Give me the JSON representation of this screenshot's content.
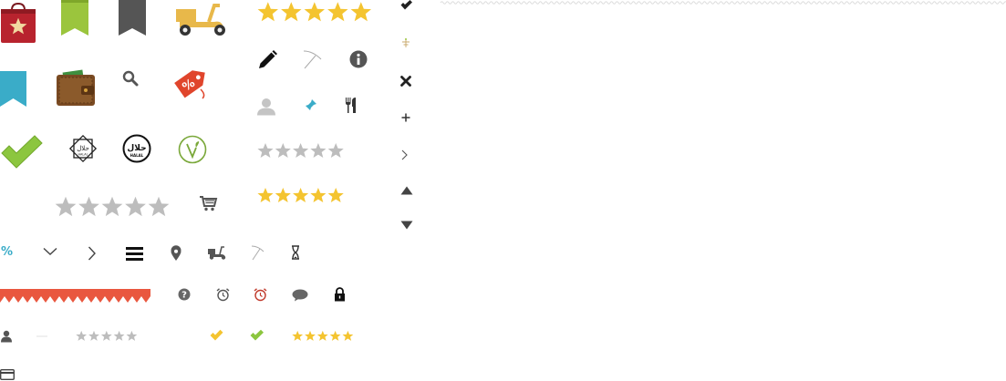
{
  "sprite_sheet": {
    "rows": {
      "row1": [
        "gift-bag-star-icon",
        "green-ribbon-bookmark-icon",
        "gray-ribbon-bookmark-icon",
        "delivery-scooter-icon"
      ],
      "row2": [
        "blue-ribbon-bookmark-icon",
        "wallet-icon",
        "search-icon",
        "discount-tag-icon"
      ],
      "row3": [
        "big-check-icon",
        "halal-star-icon",
        "halal-circle-icon",
        "vegetarian-leaf-icon"
      ],
      "row4": [
        "gray-star-rating-large",
        "shopping-cart-icon"
      ],
      "row5": [
        "percent-icon",
        "chevron-down-icon",
        "chevron-right-icon",
        "hamburger-menu-icon",
        "map-pin-icon",
        "small-scooter-icon",
        "pickaxe-icon",
        "hourglass-icon"
      ],
      "row6": [
        "orange-zigzag-banner",
        "question-icon",
        "alarm-clock-gray-icon",
        "alarm-clock-red-icon",
        "speech-bubble-icon",
        "lock-icon"
      ],
      "row7": [
        "user-icon",
        "small-gray-star-rating",
        "yellow-check-icon",
        "green-check-icon",
        "small-yellow-star-rating"
      ],
      "row8": [
        "credit-card-icon"
      ]
    },
    "column2": [
      "yellow-star-rating-large",
      "pencil-icon",
      "pickaxe-icon",
      "info-icon",
      "user-silhouette-icon",
      "pin-icon",
      "fork-knife-icon",
      "gray-star-rating",
      "yellow-star-rating"
    ],
    "column3": [
      "check-mark-icon",
      "small-plant-icon",
      "close-x-icon",
      "plus-icon",
      "chevron-right-icon",
      "triangle-up-icon",
      "triangle-down-icon"
    ],
    "ratings": {
      "gray_large": 5,
      "yellow_large": 5,
      "gray_medium": 5,
      "yellow_medium": 5,
      "gray_small": 5,
      "yellow_small": 5
    }
  },
  "labels": {
    "percent": "%",
    "halal_star": "حلال",
    "halal_star_sub": "HALAL",
    "halal_circle": "حلال",
    "halal_circle_sub": "HALAL"
  },
  "colors": {
    "gift_red": "#b8232e",
    "green": "#9bc53d",
    "ribbon_gray": "#555555",
    "scooter_yellow": "#e8b84a",
    "ribbon_blue": "#3aacc8",
    "tag_red": "#e0452c",
    "check_green": "#8cc63f",
    "star_yellow": "#f4c430",
    "star_gray": "#bdbdbd",
    "zigzag_orange": "#e9573f",
    "alarm_red": "#c0392b",
    "dark": "#222222"
  }
}
